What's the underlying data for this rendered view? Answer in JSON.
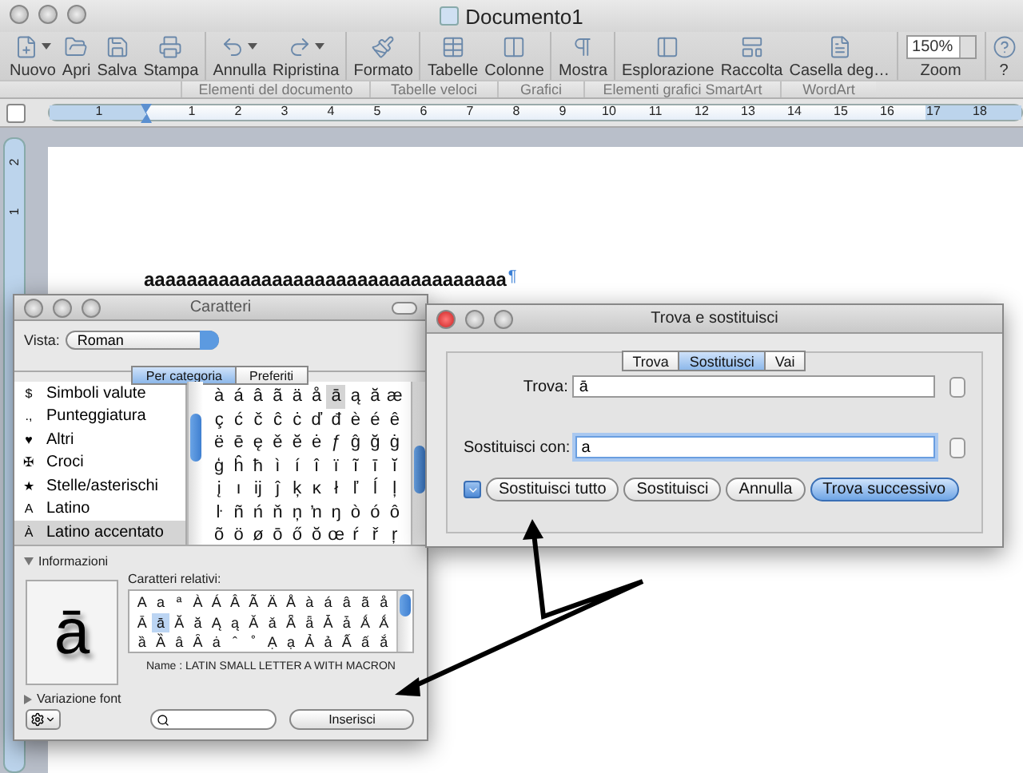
{
  "window": {
    "title": "Documento1"
  },
  "toolbar_groups": [
    {
      "items": [
        {
          "kind": "button",
          "label": "Nuovo",
          "menu": true
        },
        {
          "kind": "button",
          "label": "Apri",
          "menu": false
        },
        {
          "kind": "button",
          "label": "Salva",
          "menu": false
        },
        {
          "kind": "button",
          "label": "Stampa",
          "menu": false
        }
      ]
    },
    {
      "items": [
        {
          "kind": "button",
          "label": "Annulla",
          "menu": true
        },
        {
          "kind": "button",
          "label": "Ripristina",
          "menu": true
        }
      ]
    },
    {
      "items": [
        {
          "kind": "button",
          "label": "Formato",
          "menu": false
        }
      ]
    },
    {
      "items": [
        {
          "kind": "button",
          "label": "Tabelle",
          "menu": false
        },
        {
          "kind": "button",
          "label": "Colonne",
          "menu": false
        }
      ]
    },
    {
      "items": [
        {
          "kind": "button",
          "label": "Mostra",
          "menu": false
        }
      ]
    },
    {
      "items": [
        {
          "kind": "button",
          "label": "Esplorazione",
          "menu": false
        },
        {
          "kind": "button",
          "label": "Raccolta",
          "menu": false
        },
        {
          "kind": "button",
          "label": "Casella deg…",
          "menu": false
        }
      ]
    },
    {
      "items": [
        {
          "kind": "zoom",
          "label": "Zoom",
          "value": "150%"
        }
      ]
    },
    {
      "items": [
        {
          "kind": "button",
          "label": "?",
          "menu": false
        }
      ]
    }
  ],
  "ribbon_tabs": [
    "Elementi del documento",
    "Tabelle veloci",
    "Grafici",
    "Elementi grafici SmartArt",
    "WordArt"
  ],
  "ruler": {
    "labels": [
      "1",
      "1",
      "2",
      "3",
      "4",
      "5",
      "6",
      "7",
      "8",
      "9",
      "10",
      "11",
      "12",
      "13",
      "14",
      "15",
      "16",
      "17",
      "18"
    ]
  },
  "vertical_ruler": {
    "labels": [
      "2",
      "1"
    ]
  },
  "document": {
    "text": "aaaaaaaaaaaaaaaaaaaaaaaaaaaaaaaaaa",
    "pilcrow": "¶"
  },
  "characters_window": {
    "title": "Caratteri",
    "view_label": "Vista:",
    "view": "Roman",
    "tabs": [
      {
        "label": "Per categoria",
        "selected": true
      },
      {
        "label": "Preferiti",
        "selected": false
      }
    ],
    "categories": [
      {
        "symbol": "$",
        "label": "Simboli valute",
        "selected": false
      },
      {
        "symbol": ".,",
        "label": "Punteggiatura",
        "selected": false
      },
      {
        "symbol": "♥",
        "label": "Altri",
        "selected": false
      },
      {
        "symbol": "✠",
        "label": "Croci",
        "selected": false
      },
      {
        "symbol": "★",
        "label": "Stelle/asterischi",
        "selected": false
      },
      {
        "symbol": "A",
        "label": "Latino",
        "selected": false
      },
      {
        "symbol": "À",
        "label": "Latino accentato",
        "selected": true
      }
    ],
    "glyphs": [
      [
        {
          "char": "à",
          "selected": false
        },
        {
          "char": "á",
          "selected": false
        },
        {
          "char": "â",
          "selected": false
        },
        {
          "char": "ã",
          "selected": false
        },
        {
          "char": "ä",
          "selected": false
        },
        {
          "char": "å",
          "selected": false
        },
        {
          "char": "ā",
          "selected": true
        },
        {
          "char": "ą",
          "selected": false
        },
        {
          "char": "ă",
          "selected": false
        },
        {
          "char": "æ",
          "selected": false
        }
      ],
      [
        {
          "char": "ç",
          "selected": false
        },
        {
          "char": "ć",
          "selected": false
        },
        {
          "char": "č",
          "selected": false
        },
        {
          "char": "ĉ",
          "selected": false
        },
        {
          "char": "ċ",
          "selected": false
        },
        {
          "char": "ď",
          "selected": false
        },
        {
          "char": "đ",
          "selected": false
        },
        {
          "char": "è",
          "selected": false
        },
        {
          "char": "é",
          "selected": false
        },
        {
          "char": "ê",
          "selected": false
        }
      ],
      [
        {
          "char": "ë",
          "selected": false
        },
        {
          "char": "ē",
          "selected": false
        },
        {
          "char": "ę",
          "selected": false
        },
        {
          "char": "ě",
          "selected": false
        },
        {
          "char": "ĕ",
          "selected": false
        },
        {
          "char": "ė",
          "selected": false
        },
        {
          "char": "ƒ",
          "selected": false
        },
        {
          "char": "ĝ",
          "selected": false
        },
        {
          "char": "ğ",
          "selected": false
        },
        {
          "char": "ġ",
          "selected": false
        }
      ],
      [
        {
          "char": "ģ",
          "selected": false
        },
        {
          "char": "ĥ",
          "selected": false
        },
        {
          "char": "ħ",
          "selected": false
        },
        {
          "char": "ì",
          "selected": false
        },
        {
          "char": "í",
          "selected": false
        },
        {
          "char": "î",
          "selected": false
        },
        {
          "char": "ï",
          "selected": false
        },
        {
          "char": "ĩ",
          "selected": false
        },
        {
          "char": "ī",
          "selected": false
        },
        {
          "char": "ĭ",
          "selected": false
        }
      ],
      [
        {
          "char": "į",
          "selected": false
        },
        {
          "char": "ı",
          "selected": false
        },
        {
          "char": "ĳ",
          "selected": false
        },
        {
          "char": "ĵ",
          "selected": false
        },
        {
          "char": "ķ",
          "selected": false
        },
        {
          "char": "ĸ",
          "selected": false
        },
        {
          "char": "ł",
          "selected": false
        },
        {
          "char": "ľ",
          "selected": false
        },
        {
          "char": "ĺ",
          "selected": false
        },
        {
          "char": "ļ",
          "selected": false
        }
      ],
      [
        {
          "char": "ŀ",
          "selected": false
        },
        {
          "char": "ñ",
          "selected": false
        },
        {
          "char": "ń",
          "selected": false
        },
        {
          "char": "ň",
          "selected": false
        },
        {
          "char": "ņ",
          "selected": false
        },
        {
          "char": "ŉ",
          "selected": false
        },
        {
          "char": "ŋ",
          "selected": false
        },
        {
          "char": "ò",
          "selected": false
        },
        {
          "char": "ó",
          "selected": false
        },
        {
          "char": "ô",
          "selected": false
        }
      ],
      [
        {
          "char": "õ",
          "selected": false
        },
        {
          "char": "ö",
          "selected": false
        },
        {
          "char": "ø",
          "selected": false
        },
        {
          "char": "ō",
          "selected": false
        },
        {
          "char": "ő",
          "selected": false
        },
        {
          "char": "ŏ",
          "selected": false
        },
        {
          "char": "œ",
          "selected": false
        },
        {
          "char": "ŕ",
          "selected": false
        },
        {
          "char": "ř",
          "selected": false
        },
        {
          "char": "ŗ",
          "selected": false
        }
      ]
    ],
    "info": {
      "label": "Informazioni",
      "expanded": true,
      "preview": "ā",
      "related_label": "Caratteri relativi:",
      "related": [
        [
          {
            "char": "A",
            "selected": false
          },
          {
            "char": "a",
            "selected": false
          },
          {
            "char": "ª",
            "selected": false
          },
          {
            "char": "À",
            "selected": false
          },
          {
            "char": "Á",
            "selected": false
          },
          {
            "char": "Â",
            "selected": false
          },
          {
            "char": "Ã",
            "selected": false
          },
          {
            "char": "Ä",
            "selected": false
          },
          {
            "char": "Å",
            "selected": false
          },
          {
            "char": "à",
            "selected": false
          },
          {
            "char": "á",
            "selected": false
          },
          {
            "char": "â",
            "selected": false
          },
          {
            "char": "ã",
            "selected": false
          },
          {
            "char": "å",
            "selected": false
          }
        ],
        [
          {
            "char": "Ā",
            "selected": false
          },
          {
            "char": "ā",
            "selected": true
          },
          {
            "char": "Ă",
            "selected": false
          },
          {
            "char": "ă",
            "selected": false
          },
          {
            "char": "Ą",
            "selected": false
          },
          {
            "char": "ą",
            "selected": false
          },
          {
            "char": "Ǎ",
            "selected": false
          },
          {
            "char": "ǎ",
            "selected": false
          },
          {
            "char": "Ǟ",
            "selected": false
          },
          {
            "char": "ǟ",
            "selected": false
          },
          {
            "char": "Ǡ",
            "selected": false
          },
          {
            "char": "ǡ",
            "selected": false
          },
          {
            "char": "Ǻ",
            "selected": false
          },
          {
            "char": "Ǻ",
            "selected": false
          }
        ],
        [
          {
            "char": "ȁ",
            "selected": false
          },
          {
            "char": "Ȁ",
            "selected": false
          },
          {
            "char": "ȃ",
            "selected": false
          },
          {
            "char": "Ȃ",
            "selected": false
          },
          {
            "char": "ȧ",
            "selected": false
          },
          {
            "char": "ˆ",
            "selected": false
          },
          {
            "char": "˚",
            "selected": false
          },
          {
            "char": "Ạ",
            "selected": false
          },
          {
            "char": "ạ",
            "selected": false
          },
          {
            "char": "Ả",
            "selected": false
          },
          {
            "char": "ả",
            "selected": false
          },
          {
            "char": "Ấ",
            "selected": false
          },
          {
            "char": "ấ",
            "selected": false
          },
          {
            "char": "ắ",
            "selected": false
          }
        ]
      ],
      "name": "Name : LATIN SMALL LETTER A WITH MACRON"
    },
    "font_variation": {
      "label": "Variazione font",
      "expanded": false
    },
    "insert_button": "Inserisci"
  },
  "find_window": {
    "title": "Trova e sostituisci",
    "tabs": [
      {
        "label": "Trova",
        "selected": false
      },
      {
        "label": "Sostituisci",
        "selected": true
      },
      {
        "label": "Vai",
        "selected": false
      }
    ],
    "fields": [
      {
        "label": "Trova:",
        "value": "ā",
        "focused": false
      },
      {
        "label": "Sostituisci con:",
        "value": "a",
        "focused": true
      }
    ],
    "buttons": [
      {
        "label": "Sostituisci tutto",
        "default": false
      },
      {
        "label": "Sostituisci",
        "default": false
      },
      {
        "label": "Annulla",
        "default": false
      },
      {
        "label": "Trova successivo",
        "default": true
      }
    ]
  }
}
